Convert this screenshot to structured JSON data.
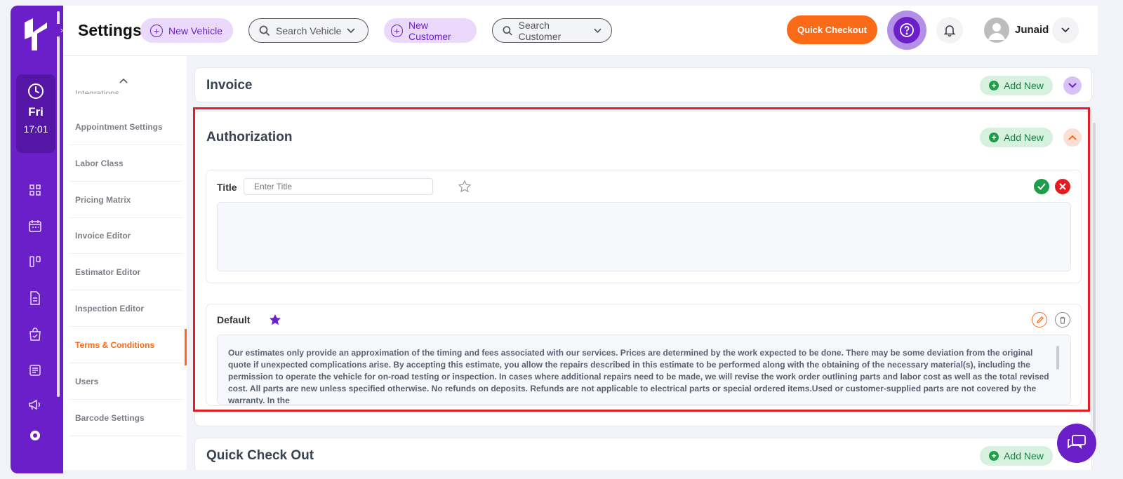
{
  "header": {
    "title": "Settings",
    "new_vehicle": "New Vehicle",
    "search_vehicle": "Search Vehicle",
    "new_customer": "New Customer",
    "search_customer": "Search Customer",
    "quick_checkout": "Quick Checkout",
    "user_name": "Junaid"
  },
  "rail": {
    "day": "Fri",
    "time": "17:01",
    "icons": [
      "dashboard-icon",
      "calendar-icon",
      "board-icon",
      "document-icon",
      "bag-icon",
      "receipt-icon",
      "megaphone-icon",
      "settings-icon"
    ]
  },
  "subnav": {
    "partial_item": "Integrations",
    "items": [
      {
        "label": "Appointment Settings",
        "active": false
      },
      {
        "label": "Labor Class",
        "active": false
      },
      {
        "label": "Pricing Matrix",
        "active": false
      },
      {
        "label": "Invoice Editor",
        "active": false
      },
      {
        "label": "Estimator Editor",
        "active": false
      },
      {
        "label": "Inspection Editor",
        "active": false
      },
      {
        "label": "Terms & Conditions",
        "active": true
      },
      {
        "label": "Users",
        "active": false
      },
      {
        "label": "Barcode Settings",
        "active": false
      }
    ]
  },
  "sections": {
    "invoice": {
      "title": "Invoice",
      "add_new": "Add New"
    },
    "authorization": {
      "title": "Authorization",
      "add_new": "Add New",
      "new_entry": {
        "title_label": "Title",
        "title_placeholder": "Enter Title",
        "body": ""
      },
      "default_entry": {
        "title": "Default",
        "text": "Our estimates only provide an approximation of the timing and fees associated with our services. Prices are determined by the work expected to be done. There may be some deviation from the original quote if unexpected complications arise. By accepting this estimate, you allow the repairs described in this estimate to be performed along with the obtaining of the necessary material(s), including the permission to operate the vehicle for on-road testing or inspection. In cases where additional repairs need to be made, we will revise the work order outlining parts and labor cost as well as the total revised cost. All parts are new unless specified otherwise. No refunds on deposits. Refunds are not applicable to electrical parts or special ordered items.Used or customer-supplied parts are not covered by the warranty. In the"
      }
    },
    "quick_check_out": {
      "title": "Quick Check Out",
      "add_new": "Add New"
    }
  },
  "colors": {
    "brand_purple": "#6a1fc8",
    "accent_orange": "#fb6a17",
    "success_green": "#1e9d4b",
    "danger_red": "#e41b23"
  }
}
